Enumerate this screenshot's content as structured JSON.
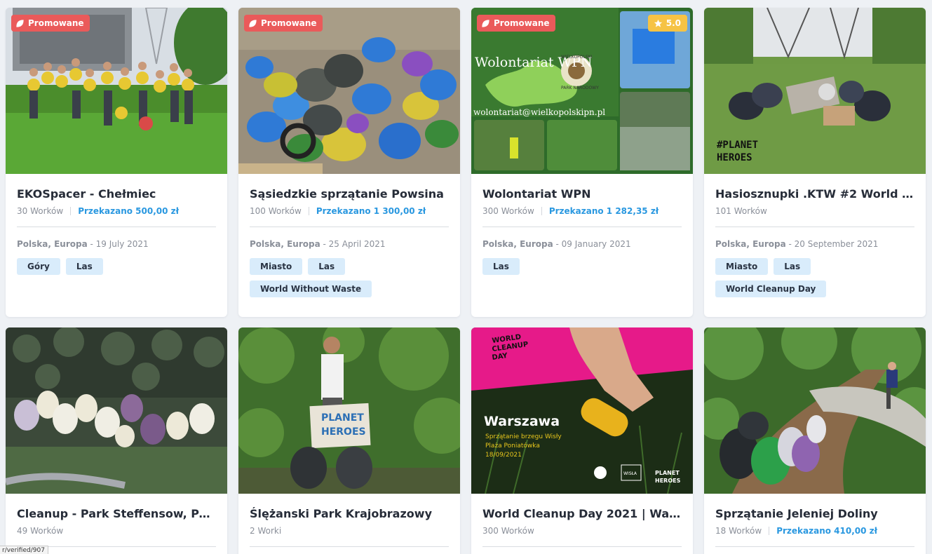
{
  "promo_label": "Promowane",
  "cards": [
    {
      "title": "EKOSpacer - Chełmiec",
      "bags": "30 Worków",
      "donated": "Przekazano 500,00 zł",
      "place": "Polska, Europa",
      "date": "19 July 2021",
      "tags": [
        "Góry",
        "Las"
      ],
      "promoted": true
    },
    {
      "title": "Sąsiedzkie sprzątanie Powsina",
      "bags": "100 Worków",
      "donated": "Przekazano 1 300,00 zł",
      "place": "Polska, Europa",
      "date": "25 April 2021",
      "tags": [
        "Miasto",
        "Las",
        "World Without Waste"
      ],
      "promoted": true
    },
    {
      "title": "Wolontariat WPN",
      "bags": "300 Worków",
      "donated": "Przekazano 1 282,35 zł",
      "place": "Polska, Europa",
      "date": "09 January 2021",
      "tags": [
        "Las"
      ],
      "promoted": true,
      "rating": "5.0",
      "image_text": {
        "heading": "Wolontariat WPN",
        "email": "wolontariat@wielkopolskipn.pl",
        "badge_top": "WIELKOPOLSKI",
        "badge_bottom": "PARK NARODOWY"
      }
    },
    {
      "title": "Hasiosznupki .KTW #2 World Clea...",
      "bags": "101 Worków",
      "donated": "",
      "place": "Polska, Europa",
      "date": "20 September 2021",
      "tags": [
        "Miasto",
        "Las",
        "World Cleanup Day"
      ],
      "promoted": false,
      "image_text": {
        "line1": "#PLANET",
        "line2": "HEROES"
      }
    },
    {
      "title": "Cleanup - Park Steffensow, Park ...",
      "bags": "49 Worków",
      "donated": "",
      "promoted": false
    },
    {
      "title": "Ślężanski Park Krajobrazowy",
      "bags": "2 Worki",
      "donated": "",
      "promoted": false,
      "image_text": {
        "line1": "PLANET",
        "line2": "HEROES"
      }
    },
    {
      "title": "World Cleanup Day 2021 | Warsza...",
      "bags": "300 Worków",
      "donated": "",
      "promoted": false,
      "image_text": {
        "wcd1": "WORLD",
        "wcd2": "CLEANUP",
        "wcd3": "DAY",
        "city": "Warszawa",
        "sub1": "Sprzątanie brzegu Wisły",
        "sub2": "Plaża Poniatówka",
        "date": "18/09/2021",
        "logo": "WISŁA",
        "ph1": "PLANET",
        "ph2": "HEROES"
      }
    },
    {
      "title": "Sprzątanie Jeleniej Doliny",
      "bags": "18 Worków",
      "donated": "Przekazano 410,00 zł",
      "promoted": false
    }
  ],
  "status_url": "r/verified/907",
  "colors": {
    "promo": "#ea5a5a",
    "rating": "#f6c344",
    "donated": "#2a98e0",
    "tag_bg": "#d9ecfb"
  }
}
